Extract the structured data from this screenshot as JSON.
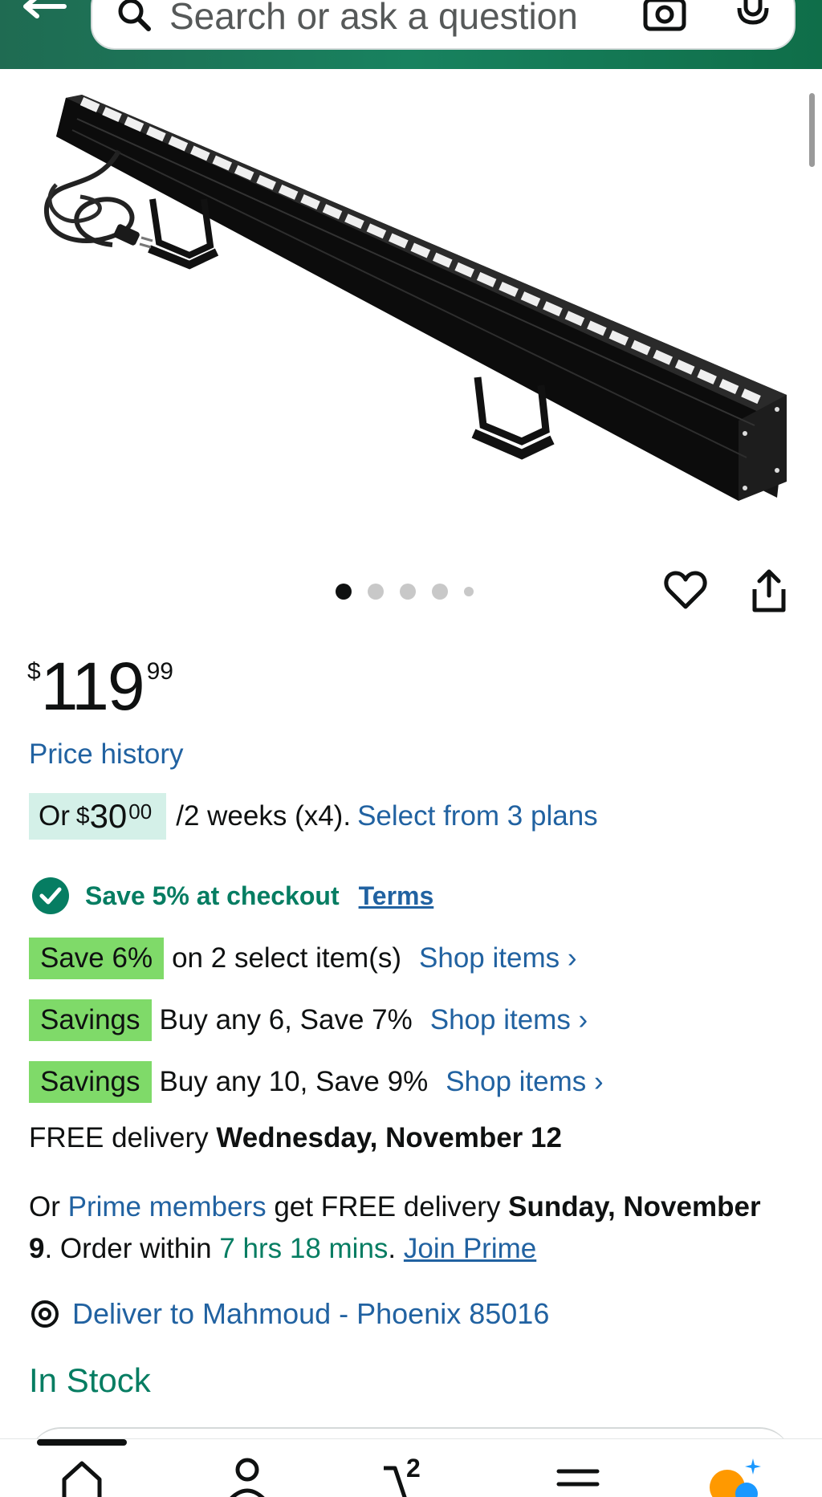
{
  "header": {
    "search_placeholder": "Search or ask a question"
  },
  "carousel": {
    "total_dots": 5,
    "active_index": 0
  },
  "price": {
    "symbol": "$",
    "whole": "119",
    "fraction": "99"
  },
  "price_history_label": "Price history",
  "installment": {
    "prefix": "Or",
    "symbol": "$",
    "whole": "30",
    "fraction": "00",
    "rest": "/2 weeks (x4).",
    "link": "Select from 3 plans"
  },
  "checkout_coupon": {
    "text": "Save 5% at checkout",
    "terms": "Terms"
  },
  "promotions": [
    {
      "badge": "Save 6%",
      "text": "on 2 select item(s)",
      "link": "Shop items ›"
    },
    {
      "badge": "Savings",
      "text": "Buy any 6, Save 7%",
      "link": "Shop items ›"
    },
    {
      "badge": "Savings",
      "text": "Buy any 10, Save 9%",
      "link": "Shop items ›"
    }
  ],
  "delivery": {
    "prefix": "FREE delivery",
    "date": "Wednesday, November 12"
  },
  "prime_delivery": {
    "or": "Or",
    "members_link": "Prime members",
    "get_text": "get FREE delivery",
    "date": "Sunday, November 9",
    "order_within": ". Order within",
    "countdown": "7 hrs 18 mins",
    "period": ".",
    "join_link": "Join Prime"
  },
  "deliver_to": "Deliver to Mahmoud - Phoenix 85016",
  "stock_status": "In Stock",
  "tabbar": {
    "cart_count": "2"
  },
  "colors": {
    "header_green": "#18825f",
    "link_blue": "#2162a1",
    "success_green": "#067d62",
    "badge_green": "#7fda69",
    "installment_bg": "#d4f0e8"
  }
}
